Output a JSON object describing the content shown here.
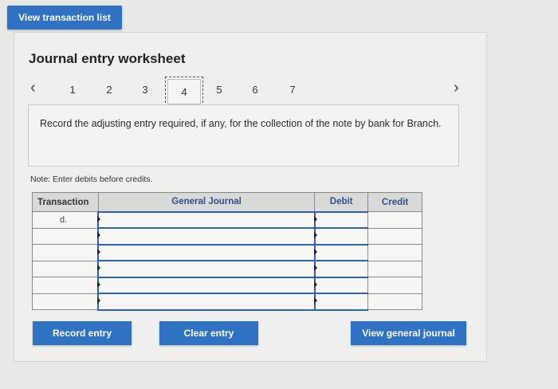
{
  "top": {
    "view_transaction_list": "View transaction list"
  },
  "worksheet": {
    "title": "Journal entry worksheet",
    "pages": [
      "1",
      "2",
      "3",
      "4",
      "5",
      "6",
      "7"
    ],
    "active_page": "4",
    "instruction": "Record the adjusting entry required, if any, for the collection of the note by bank for Branch.",
    "note": "Note: Enter debits before credits."
  },
  "table": {
    "headers": {
      "transaction": "Transaction",
      "general_journal": "General Journal",
      "debit": "Debit",
      "credit": "Credit"
    },
    "rows": [
      {
        "transaction": "d.",
        "account": "",
        "debit": "",
        "credit": ""
      },
      {
        "transaction": "",
        "account": "",
        "debit": "",
        "credit": ""
      },
      {
        "transaction": "",
        "account": "",
        "debit": "",
        "credit": ""
      },
      {
        "transaction": "",
        "account": "",
        "debit": "",
        "credit": ""
      },
      {
        "transaction": "",
        "account": "",
        "debit": "",
        "credit": ""
      },
      {
        "transaction": "",
        "account": "",
        "debit": "",
        "credit": ""
      }
    ]
  },
  "buttons": {
    "record_entry": "Record entry",
    "clear_entry": "Clear entry",
    "view_general_journal": "View general journal"
  },
  "colors": {
    "accent": "#2f72c4",
    "field_border": "#2e62b4"
  },
  "icons": {
    "prev": "chevron-left-icon",
    "next": "chevron-right-icon"
  }
}
